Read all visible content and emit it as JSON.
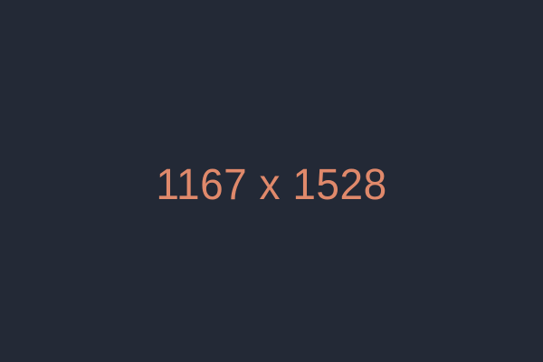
{
  "placeholder": {
    "label": "1167 x 1528",
    "background_color": "#232936",
    "text_color": "#e0896b"
  }
}
